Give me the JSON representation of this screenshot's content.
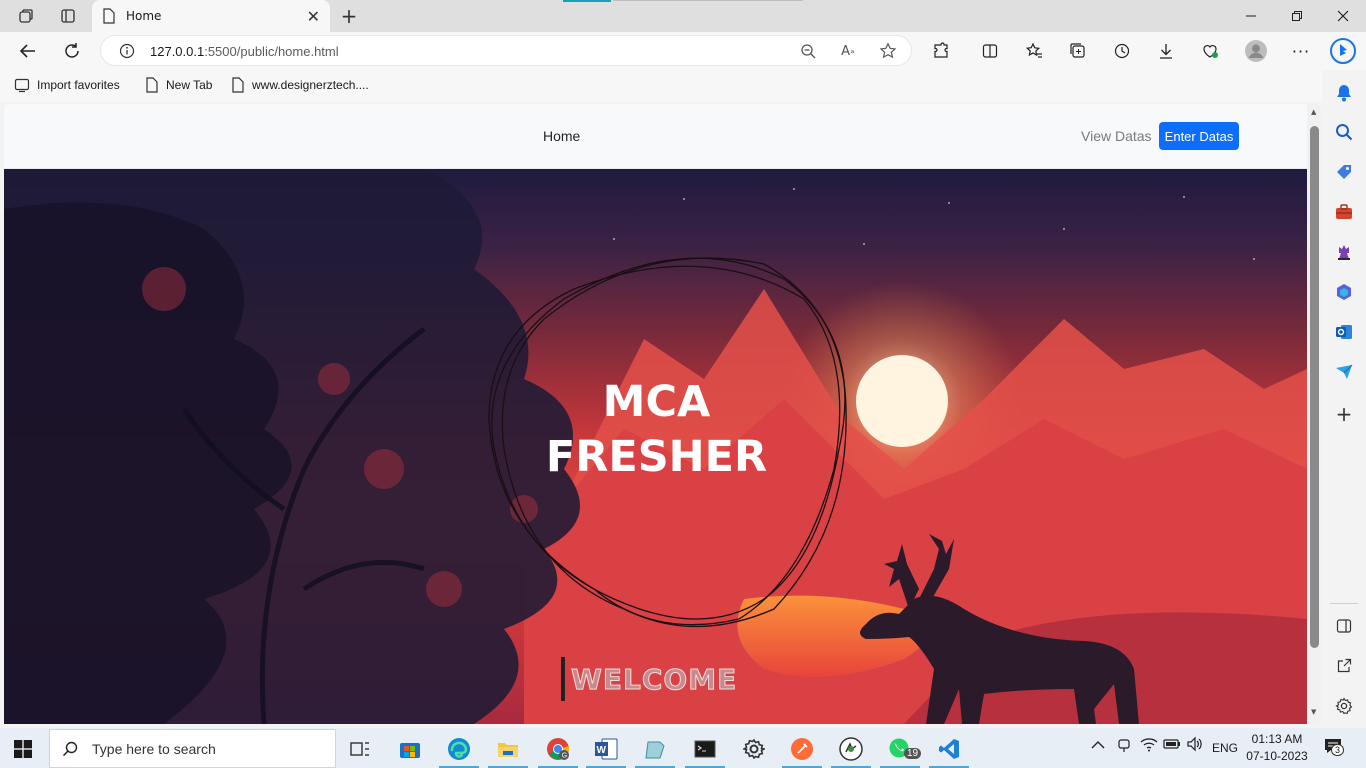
{
  "browser": {
    "tab_title": "Home",
    "url_host": "127.0.0.1",
    "url_path": ":5500/public/home.html",
    "favorites": [
      {
        "label": "Import favorites"
      },
      {
        "label": "New Tab"
      },
      {
        "label": "www.designerztech...."
      }
    ]
  },
  "page": {
    "nav": {
      "home": "Home",
      "view": "View Datas",
      "enter": "Enter Datas"
    },
    "hero": {
      "title_line1": "MCA",
      "title_line2": "FRESHER",
      "welcome": "WELCOME"
    }
  },
  "taskbar": {
    "search_placeholder": "Type here to search",
    "whatsapp_badge": "19",
    "language": "ENG",
    "time": "01:13 AM",
    "date": "07-10-2023",
    "notifications": "3"
  },
  "colors": {
    "accent": "#0d6efd",
    "edge_blue": "#1a73e8"
  }
}
